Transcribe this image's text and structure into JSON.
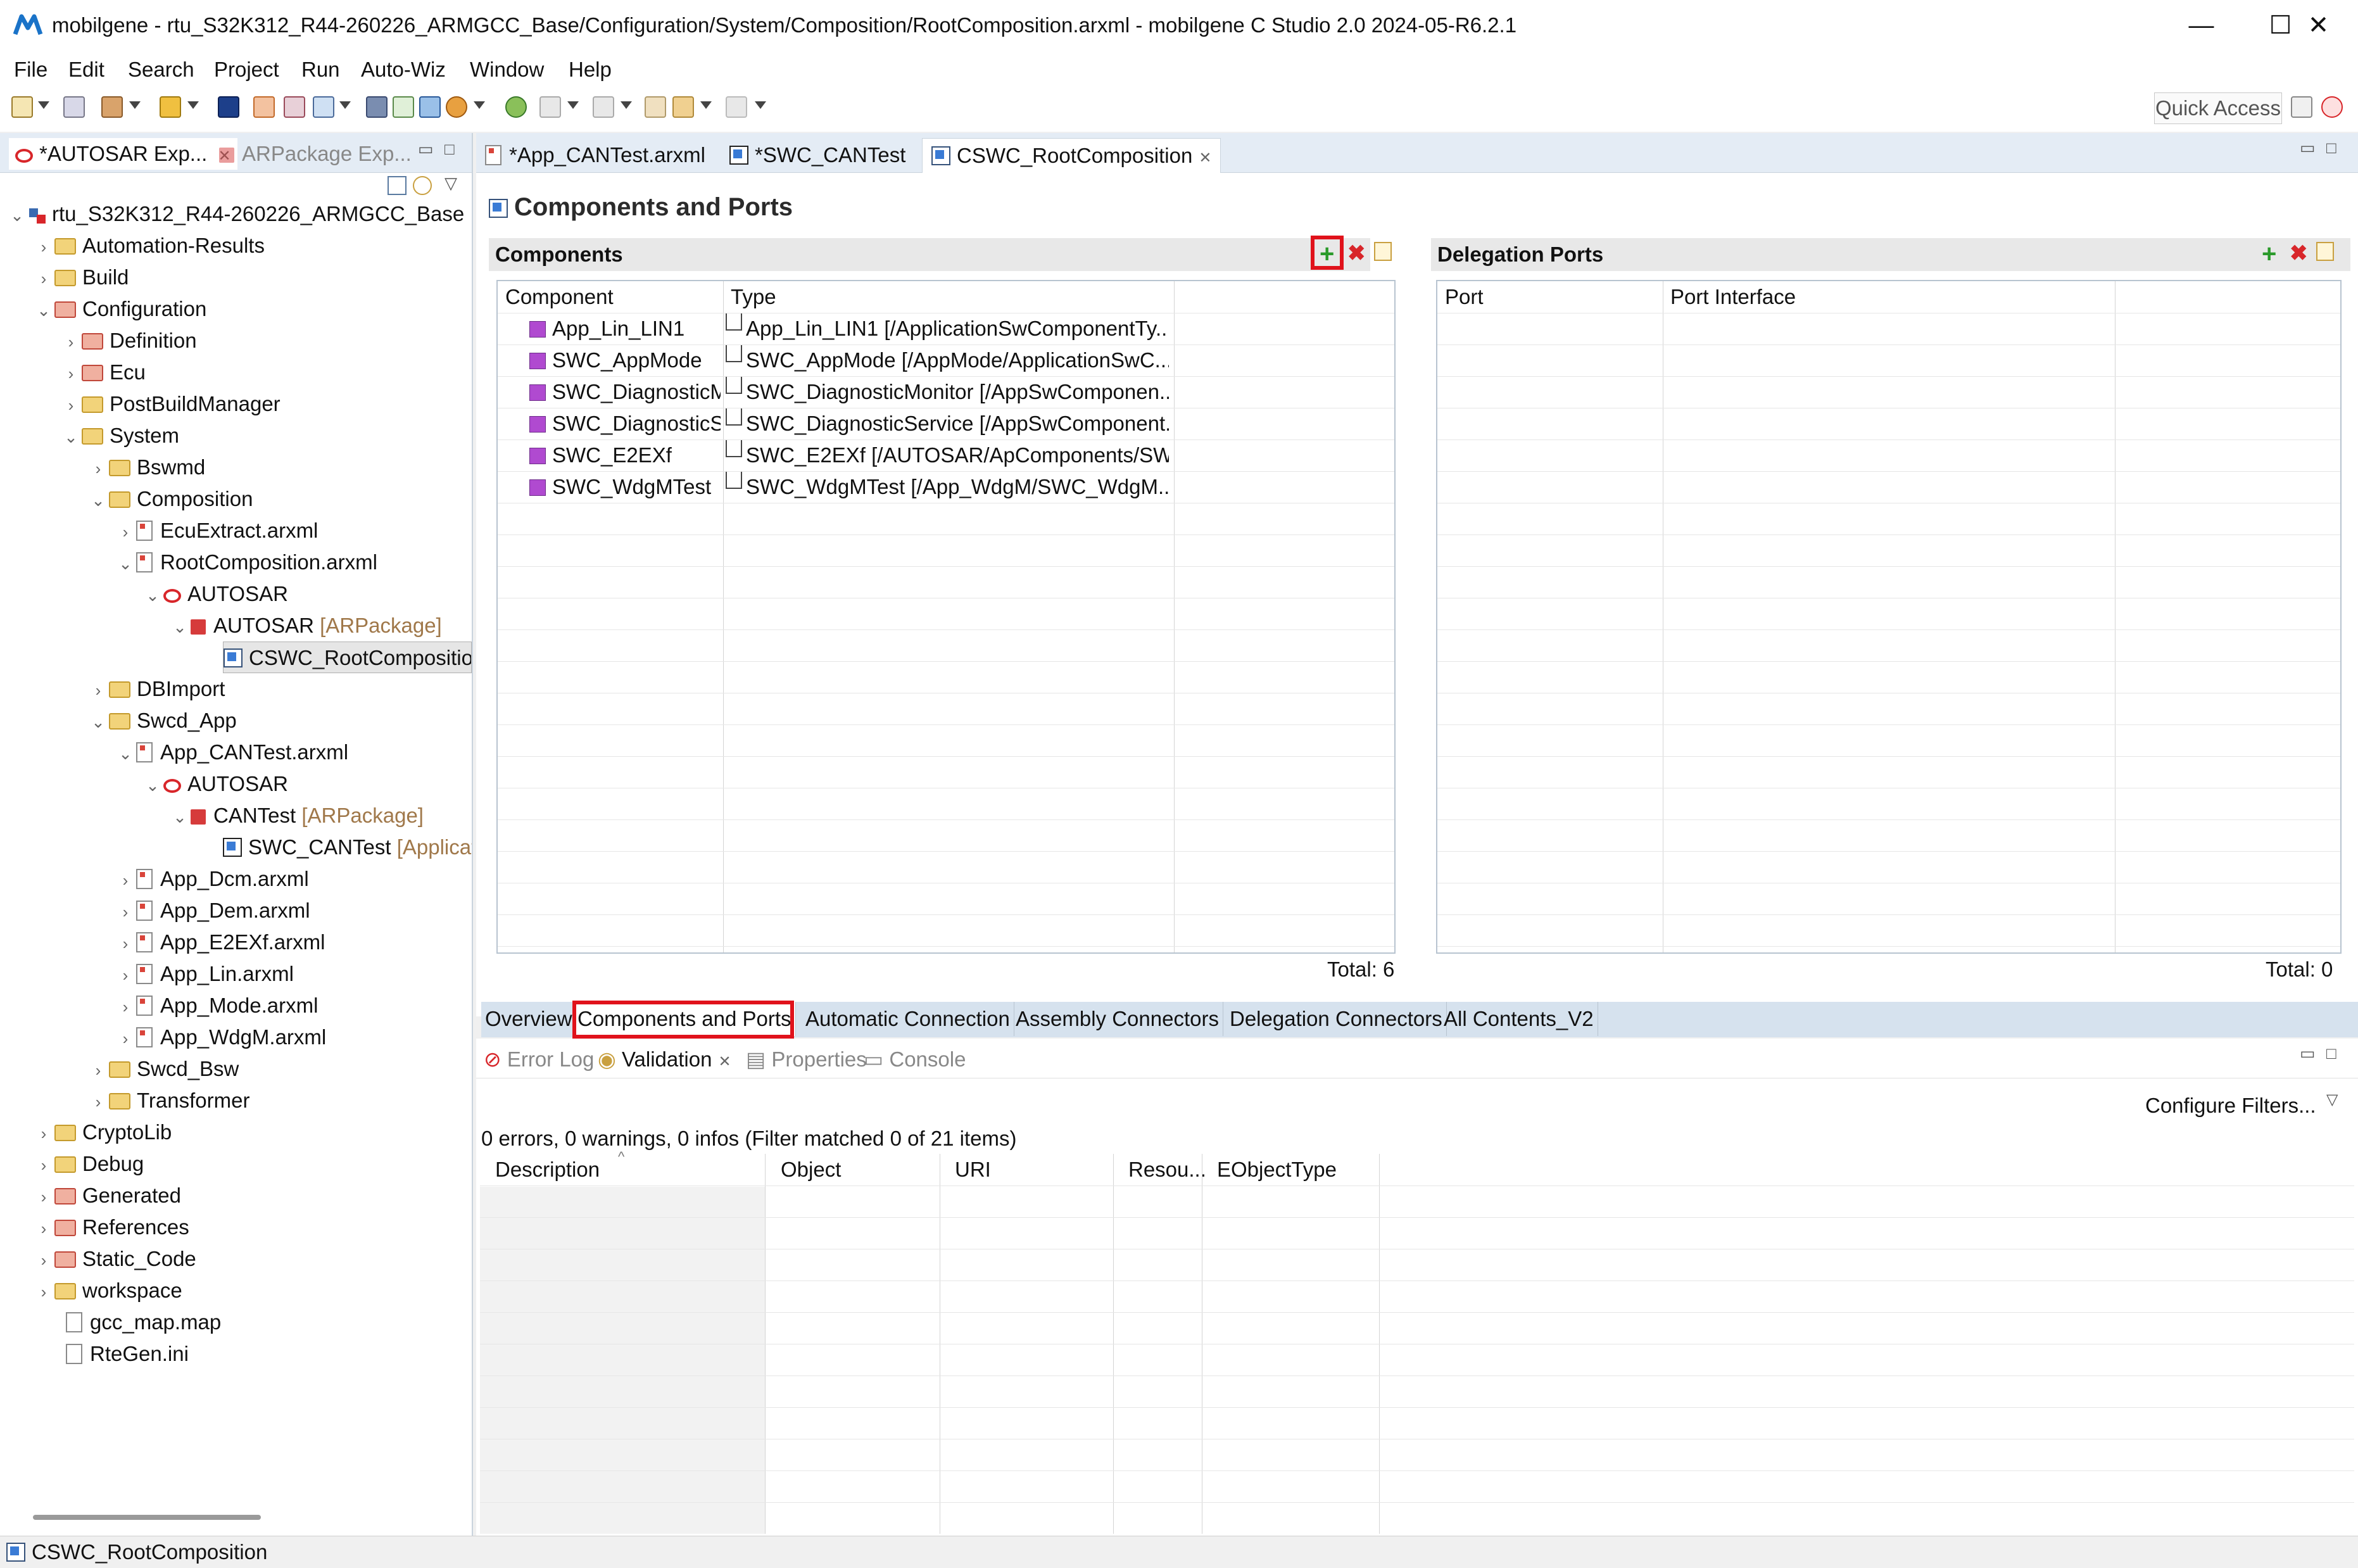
{
  "window": {
    "title": "mobilgene - rtu_S32K312_R44-260226_ARMGCC_Base/Configuration/System/Composition/RootComposition.arxml - mobilgene C Studio 2.0 2024-05-R6.2.1",
    "minimize": "—",
    "maximize": "☐",
    "close": "✕"
  },
  "menu": [
    "File",
    "Edit",
    "Search",
    "Project",
    "Run",
    "Auto-Wiz",
    "Window",
    "Help"
  ],
  "toolbar": {
    "quick_access": "Quick Access"
  },
  "left_tabs": {
    "autosar_explorer": "*AUTOSAR Exp...",
    "arpackage_explorer": "ARPackage Exp..."
  },
  "tree": {
    "root": "rtu_S32K312_R44-260226_ARMGCC_Base",
    "automation_results": "Automation-Results",
    "build": "Build",
    "configuration": "Configuration",
    "definition": "Definition",
    "ecu": "Ecu",
    "postbuildmanager": "PostBuildManager",
    "system": "System",
    "bswmd": "Bswmd",
    "composition": "Composition",
    "ecuextract": "EcuExtract.arxml",
    "rootcomposition": "RootComposition.arxml",
    "autosar1": "AUTOSAR",
    "autosar_pkg1": "AUTOSAR",
    "arpackage_tag": "[ARPackage]",
    "cswc_root": "CSWC_RootCompositior",
    "dbimport": "DBImport",
    "swcd_app": "Swcd_App",
    "app_cantest": "App_CANTest.arxml",
    "autosar2": "AUTOSAR",
    "cantest_pkg": "CANTest",
    "swc_cantest": "SWC_CANTest",
    "applicat_tag": "[Applicat",
    "app_dcm": "App_Dcm.arxml",
    "app_dem": "App_Dem.arxml",
    "app_e2exf": "App_E2EXf.arxml",
    "app_lin": "App_Lin.arxml",
    "app_mode": "App_Mode.arxml",
    "app_wdgm": "App_WdgM.arxml",
    "swcd_bsw": "Swcd_Bsw",
    "transformer": "Transformer",
    "cryptolib": "CryptoLib",
    "debug": "Debug",
    "generated": "Generated",
    "references": "References",
    "static_code": "Static_Code",
    "workspace": "workspace",
    "gcc_map": "gcc_map.map",
    "rtegen": "RteGen.ini"
  },
  "editor_tabs": {
    "app_cantest": "*App_CANTest.arxml",
    "swc_cantest": "*SWC_CANTest",
    "cswc_root": "CSWC_RootComposition"
  },
  "editor": {
    "heading": "Components and Ports",
    "components_title": "Components",
    "delegation_title": "Delegation Ports",
    "comp_col_component": "Component",
    "comp_col_type": "Type",
    "deleg_col_port": "Port",
    "deleg_col_interface": "Port Interface",
    "components": [
      {
        "name": "App_Lin_LIN1",
        "type": "App_Lin_LIN1 [/ApplicationSwComponentTy..."
      },
      {
        "name": "SWC_AppMode",
        "type": "SWC_AppMode [/AppMode/ApplicationSwC..."
      },
      {
        "name": "SWC_DiagnosticMo",
        "type": "SWC_DiagnosticMonitor [/AppSwComponen..."
      },
      {
        "name": "SWC_DiagnosticSe",
        "type": "SWC_DiagnosticService [/AppSwComponent..."
      },
      {
        "name": "SWC_E2EXf",
        "type": "SWC_E2EXf [/AUTOSAR/ApComponents/SW..."
      },
      {
        "name": "SWC_WdgMTest",
        "type": "SWC_WdgMTest [/App_WdgM/SWC_WdgM..."
      }
    ],
    "components_total": "Total: 6",
    "delegation_total": "Total: 0",
    "page_tabs": [
      "Overview",
      "Components and Ports",
      "Automatic Connection",
      "Assembly Connectors",
      "Delegation Connectors",
      "All Contents_V2"
    ]
  },
  "bottom": {
    "tabs": {
      "error_log": "Error Log",
      "validation": "Validation",
      "properties": "Properties",
      "console": "Console"
    },
    "configure_filters": "Configure Filters...",
    "summary": "0 errors, 0 warnings, 0 infos (Filter matched 0 of 21 items)",
    "columns": [
      "Description",
      "Object",
      "URI",
      "Resou...",
      "EObjectType"
    ]
  },
  "status": {
    "text": "CSWC_RootComposition"
  },
  "colors": {
    "accent": "#1a73c8",
    "highlight": "#e0121b",
    "tab_bar": "#e4ecf5"
  }
}
